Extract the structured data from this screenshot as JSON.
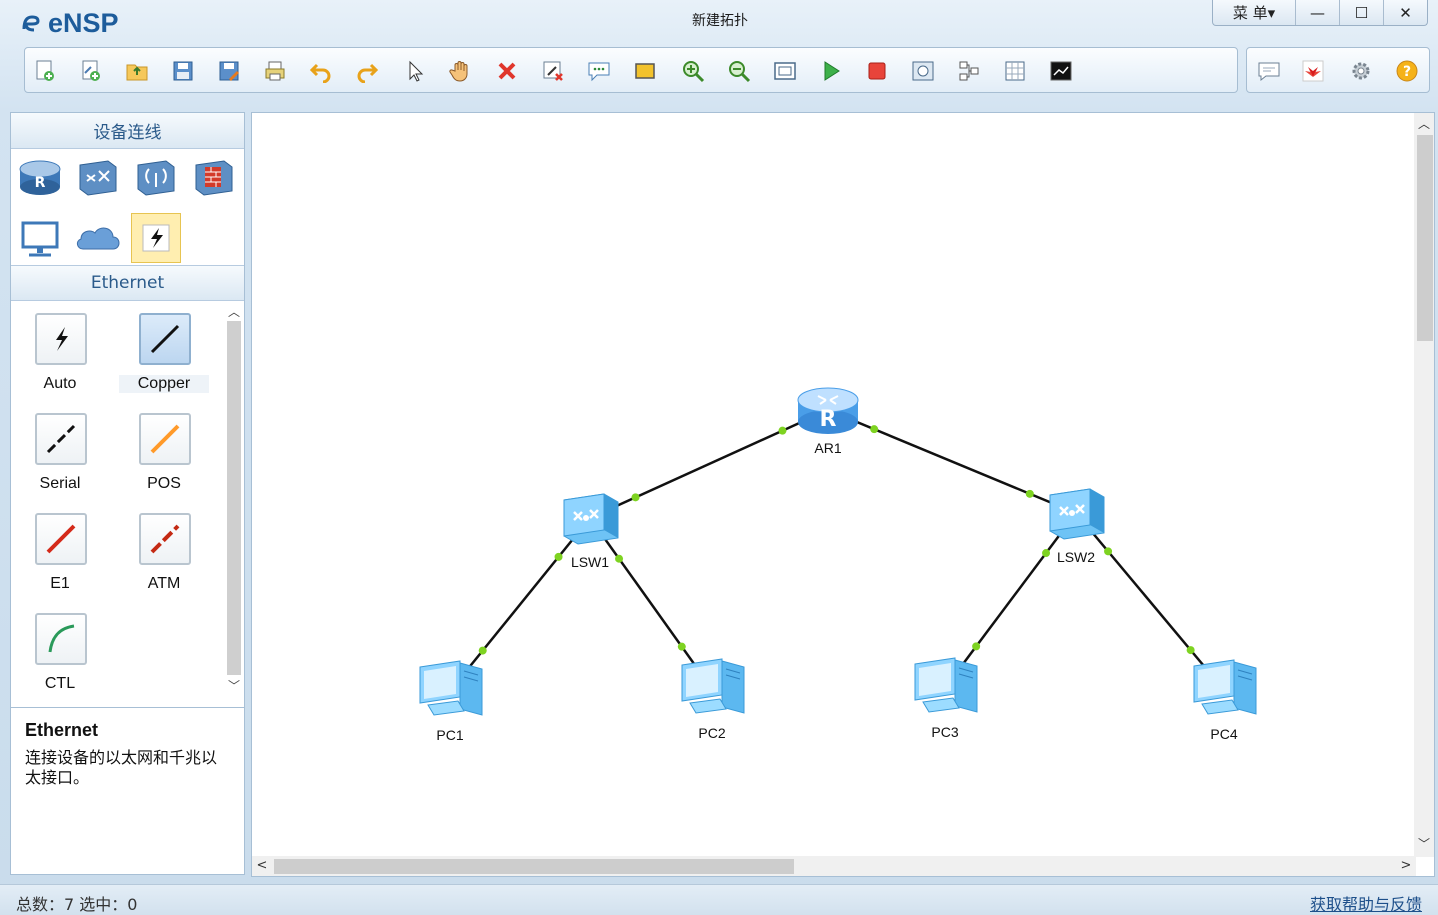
{
  "app": {
    "name": "eNSP",
    "window_title": "新建拓扑"
  },
  "window_controls": {
    "menu_label": "菜 单▾",
    "minimize": "—",
    "maximize": "☐",
    "close": "✕"
  },
  "toolbar": {
    "buttons": [
      "new-topology-icon",
      "new-example-icon",
      "open-icon",
      "save-icon",
      "save-as-icon",
      "print-icon",
      "undo-icon",
      "redo-icon",
      "select-icon",
      "pan-hand-icon",
      "delete-icon",
      "delete-link-icon",
      "text-annotation-icon",
      "rectangle-icon",
      "zoom-in-icon",
      "zoom-out-icon",
      "fit-view-icon",
      "start-device-icon",
      "stop-device-icon",
      "capture-icon",
      "topology-icon",
      "grid-icon",
      "console-icon"
    ],
    "right_buttons": [
      "message-icon",
      "huawei-logo-icon",
      "settings-gear-icon",
      "help-icon"
    ]
  },
  "left_panel": {
    "title": "设备连线",
    "device_categories": [
      "router-icon",
      "switch-icon",
      "wireless-icon",
      "firewall-icon",
      "pc-terminal-icon",
      "cloud-icon",
      "cable-icon"
    ],
    "selected_category": "cable-icon",
    "section_title": "Ethernet",
    "cables": [
      {
        "name": "Auto",
        "color": "#111111"
      },
      {
        "name": "Copper",
        "color": "#111111"
      },
      {
        "name": "Serial",
        "color": "#111111"
      },
      {
        "name": "POS",
        "color": "#ff9a2a"
      },
      {
        "name": "E1",
        "color": "#d42a1a"
      },
      {
        "name": "ATM",
        "color": "#c42a14"
      },
      {
        "name": "CTL",
        "color": "#2a9a5a"
      }
    ],
    "selected_cable": "Copper",
    "description": {
      "title": "Ethernet",
      "text": "连接设备的以太网和千兆以太接口。"
    }
  },
  "topology": {
    "nodes": [
      {
        "id": "AR1",
        "type": "router",
        "label": "AR1"
      },
      {
        "id": "LSW1",
        "type": "switch",
        "label": "LSW1"
      },
      {
        "id": "LSW2",
        "type": "switch",
        "label": "LSW2"
      },
      {
        "id": "PC1",
        "type": "pc",
        "label": "PC1"
      },
      {
        "id": "PC2",
        "type": "pc",
        "label": "PC2"
      },
      {
        "id": "PC3",
        "type": "pc",
        "label": "PC3"
      },
      {
        "id": "PC4",
        "type": "pc",
        "label": "PC4"
      }
    ],
    "links": [
      [
        "AR1",
        "LSW1"
      ],
      [
        "AR1",
        "LSW2"
      ],
      [
        "LSW1",
        "PC1"
      ],
      [
        "LSW1",
        "PC2"
      ],
      [
        "LSW2",
        "PC3"
      ],
      [
        "LSW2",
        "PC4"
      ]
    ],
    "link_color": "#111111",
    "port_status_color": "#7ed321"
  },
  "status_bar": {
    "text": "总数：7  选中：0",
    "help_link": "获取帮助与反馈"
  }
}
